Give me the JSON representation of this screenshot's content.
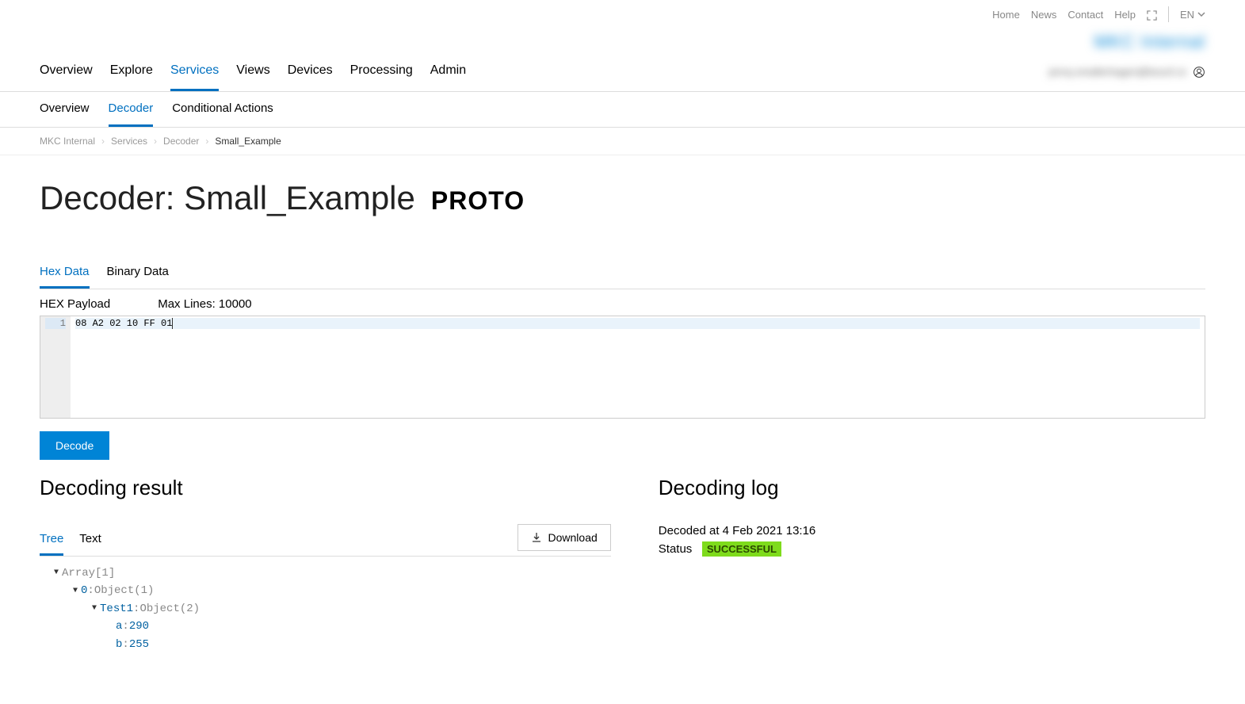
{
  "topLinks": {
    "home": "Home",
    "news": "News",
    "contact": "Contact",
    "help": "Help",
    "lang": "EN"
  },
  "logo": "MKC Internal",
  "mainNav": {
    "overview": "Overview",
    "explore": "Explore",
    "services": "Services",
    "views": "Views",
    "devices": "Devices",
    "processing": "Processing",
    "admin": "Admin"
  },
  "userText": "jenny.smallerhagen@bosch.io",
  "subNav": {
    "overview": "Overview",
    "decoder": "Decoder",
    "conditionalActions": "Conditional Actions"
  },
  "breadcrumb": {
    "root": "MKC Internal",
    "services": "Services",
    "decoder": "Decoder",
    "current": "Small_Example"
  },
  "pageTitle": "Decoder: Small_Example",
  "pageBadge": "PROTO",
  "dataTabs": {
    "hex": "Hex Data",
    "binary": "Binary Data"
  },
  "payloadLabel": "HEX Payload",
  "maxLinesLabel": "Max Lines: 10000",
  "lineNumber": "1",
  "hexContent": "08 A2 02 10 FF 01",
  "decodeButton": "Decode",
  "resultTitle": "Decoding result",
  "resultTabs": {
    "tree": "Tree",
    "text": "Text"
  },
  "downloadLabel": "Download",
  "tree": {
    "root": "Array[1]",
    "idx0key": "0",
    "idx0type": "Object(1)",
    "test1key": "Test1",
    "test1type": "Object(2)",
    "akey": "a",
    "aval": "290",
    "bkey": "b",
    "bval": "255"
  },
  "logTitle": "Decoding log",
  "decodedAt": "Decoded at 4 Feb 2021 13:16",
  "statusLabel": "Status",
  "statusValue": "SUCCESSFUL"
}
